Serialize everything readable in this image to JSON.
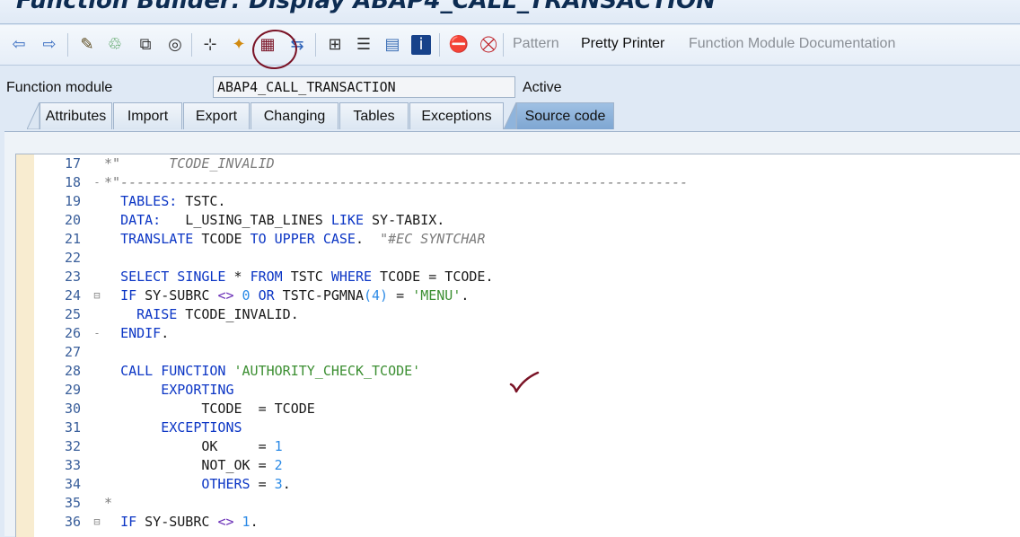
{
  "window": {
    "title": "Function Builder: Display ABAP4_CALL_TRANSACTION"
  },
  "toolbar": {
    "icons": [
      "back-arrow-icon",
      "forward-arrow-icon",
      "edit-pencil-icon",
      "display-change-icon",
      "copy-object-icon",
      "where-used-icon",
      "hierarchy-icon",
      "activate-icon",
      "test-icon",
      "navigate-icon",
      "tree-icon",
      "stack-icon",
      "object-list-icon",
      "info-icon",
      "breakpoint-icon",
      "stop-icon"
    ],
    "pattern": "Pattern",
    "pretty_printer": "Pretty Printer",
    "fm_documentation": "Function Module Documentation"
  },
  "function_module": {
    "label": "Function module",
    "value": "ABAP4_CALL_TRANSACTION",
    "status": "Active"
  },
  "tabs": [
    {
      "label": "Attributes"
    },
    {
      "label": "Import"
    },
    {
      "label": "Export"
    },
    {
      "label": "Changing"
    },
    {
      "label": "Tables"
    },
    {
      "label": "Exceptions"
    },
    {
      "label": "Source code",
      "selected": true
    }
  ],
  "source": {
    "lines": [
      {
        "n": "17",
        "fold": "",
        "tokens": [
          {
            "t": "*\"",
            "c": "com"
          },
          {
            "t": "      TCODE_INVALID",
            "c": "com"
          }
        ]
      },
      {
        "n": "18",
        "fold": "-",
        "tokens": [
          {
            "t": "*\"----------------------------------------------------------------------",
            "c": "com"
          }
        ]
      },
      {
        "n": "19",
        "fold": "",
        "tokens": [
          {
            "t": "  ",
            "c": "plain"
          },
          {
            "t": "TABLES:",
            "c": "kw"
          },
          {
            "t": " TSTC.",
            "c": "plain"
          }
        ]
      },
      {
        "n": "20",
        "fold": "",
        "tokens": [
          {
            "t": "  ",
            "c": "plain"
          },
          {
            "t": "DATA:",
            "c": "kw"
          },
          {
            "t": "   L_USING_TAB_LINES ",
            "c": "plain"
          },
          {
            "t": "LIKE",
            "c": "kw"
          },
          {
            "t": " SY-TABIX.",
            "c": "plain"
          }
        ]
      },
      {
        "n": "21",
        "fold": "",
        "tokens": [
          {
            "t": "  ",
            "c": "plain"
          },
          {
            "t": "TRANSLATE",
            "c": "kw"
          },
          {
            "t": " TCODE ",
            "c": "plain"
          },
          {
            "t": "TO",
            "c": "kw"
          },
          {
            "t": " ",
            "c": "plain"
          },
          {
            "t": "UPPER CASE",
            "c": "kw"
          },
          {
            "t": ".  ",
            "c": "plain"
          },
          {
            "t": "\"#EC SYNTCHAR",
            "c": "com"
          }
        ]
      },
      {
        "n": "22",
        "fold": "",
        "tokens": []
      },
      {
        "n": "23",
        "fold": "",
        "tokens": [
          {
            "t": "  ",
            "c": "plain"
          },
          {
            "t": "SELECT SINGLE",
            "c": "kw"
          },
          {
            "t": " * ",
            "c": "plain"
          },
          {
            "t": "FROM",
            "c": "kw"
          },
          {
            "t": " TSTC ",
            "c": "plain"
          },
          {
            "t": "WHERE",
            "c": "kw"
          },
          {
            "t": " TCODE = TCODE.",
            "c": "plain"
          }
        ]
      },
      {
        "n": "24",
        "fold": "⊟",
        "tokens": [
          {
            "t": "  ",
            "c": "plain"
          },
          {
            "t": "IF",
            "c": "kw"
          },
          {
            "t": " SY-SUBRC ",
            "c": "plain"
          },
          {
            "t": "<>",
            "c": "op"
          },
          {
            "t": " ",
            "c": "plain"
          },
          {
            "t": "0",
            "c": "num"
          },
          {
            "t": " ",
            "c": "plain"
          },
          {
            "t": "OR",
            "c": "kw"
          },
          {
            "t": " TSTC-PGMNA",
            "c": "plain"
          },
          {
            "t": "(4)",
            "c": "num"
          },
          {
            "t": " = ",
            "c": "plain"
          },
          {
            "t": "'MENU'",
            "c": "str"
          },
          {
            "t": ".",
            "c": "plain"
          }
        ]
      },
      {
        "n": "25",
        "fold": "",
        "tokens": [
          {
            "t": "    ",
            "c": "plain"
          },
          {
            "t": "RAISE",
            "c": "kw"
          },
          {
            "t": " TCODE_INVALID.",
            "c": "plain"
          }
        ]
      },
      {
        "n": "26",
        "fold": "-",
        "tokens": [
          {
            "t": "  ",
            "c": "plain"
          },
          {
            "t": "ENDIF",
            "c": "kw"
          },
          {
            "t": ".",
            "c": "plain"
          }
        ]
      },
      {
        "n": "27",
        "fold": "",
        "tokens": []
      },
      {
        "n": "28",
        "fold": "",
        "tokens": [
          {
            "t": "  ",
            "c": "plain"
          },
          {
            "t": "CALL FUNCTION",
            "c": "kw"
          },
          {
            "t": " ",
            "c": "plain"
          },
          {
            "t": "'AUTHORITY_CHECK_TCODE'",
            "c": "str"
          }
        ]
      },
      {
        "n": "29",
        "fold": "",
        "tokens": [
          {
            "t": "       ",
            "c": "plain"
          },
          {
            "t": "EXPORTING",
            "c": "kw"
          }
        ]
      },
      {
        "n": "30",
        "fold": "",
        "tokens": [
          {
            "t": "            TCODE  = TCODE",
            "c": "plain"
          }
        ]
      },
      {
        "n": "31",
        "fold": "",
        "tokens": [
          {
            "t": "       ",
            "c": "plain"
          },
          {
            "t": "EXCEPTIONS",
            "c": "kw"
          }
        ]
      },
      {
        "n": "32",
        "fold": "",
        "tokens": [
          {
            "t": "            OK     = ",
            "c": "plain"
          },
          {
            "t": "1",
            "c": "num"
          }
        ]
      },
      {
        "n": "33",
        "fold": "",
        "tokens": [
          {
            "t": "            NOT_OK = ",
            "c": "plain"
          },
          {
            "t": "2",
            "c": "num"
          }
        ]
      },
      {
        "n": "34",
        "fold": "",
        "tokens": [
          {
            "t": "            ",
            "c": "plain"
          },
          {
            "t": "OTHERS",
            "c": "kw"
          },
          {
            "t": " = ",
            "c": "plain"
          },
          {
            "t": "3",
            "c": "num"
          },
          {
            "t": ".",
            "c": "plain"
          }
        ]
      },
      {
        "n": "35",
        "fold": "",
        "tokens": [
          {
            "t": "*",
            "c": "com"
          }
        ]
      },
      {
        "n": "36",
        "fold": "⊟",
        "tokens": [
          {
            "t": "  ",
            "c": "plain"
          },
          {
            "t": "IF",
            "c": "kw"
          },
          {
            "t": " SY-SUBRC ",
            "c": "plain"
          },
          {
            "t": "<>",
            "c": "op"
          },
          {
            "t": " ",
            "c": "plain"
          },
          {
            "t": "1",
            "c": "num"
          },
          {
            "t": ".",
            "c": "plain"
          }
        ]
      }
    ]
  }
}
